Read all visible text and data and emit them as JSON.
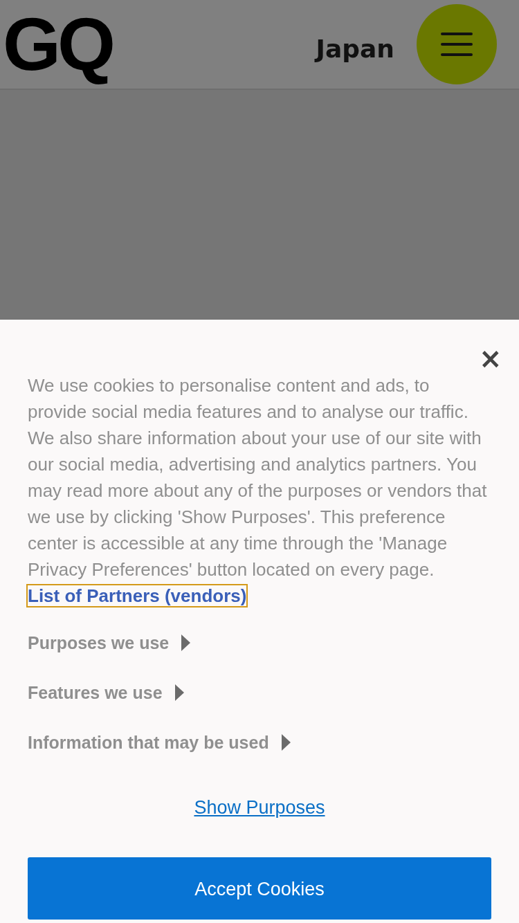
{
  "header": {
    "logo": "GQ",
    "edition": "Japan"
  },
  "consent": {
    "close": "×",
    "message": "We use cookies to personalise content and ads, to provide social media features and to analyse our traffic. We also share information about your use of our site with our social media, advertising and analytics partners. You may read more about any of the purposes or vendors that we use by clicking 'Show Purposes'. This preference center is accessible at any time through the 'Manage Privacy Preferences' button located on every page.",
    "partners_link": "List of Partners (vendors)",
    "sections": [
      {
        "label": "Purposes we use",
        "expanded": false
      },
      {
        "label": "Features we use",
        "expanded": false
      },
      {
        "label": "Information that may be used",
        "expanded": false
      }
    ],
    "show_purposes": "Show Purposes",
    "accept": "Accept Cookies"
  }
}
